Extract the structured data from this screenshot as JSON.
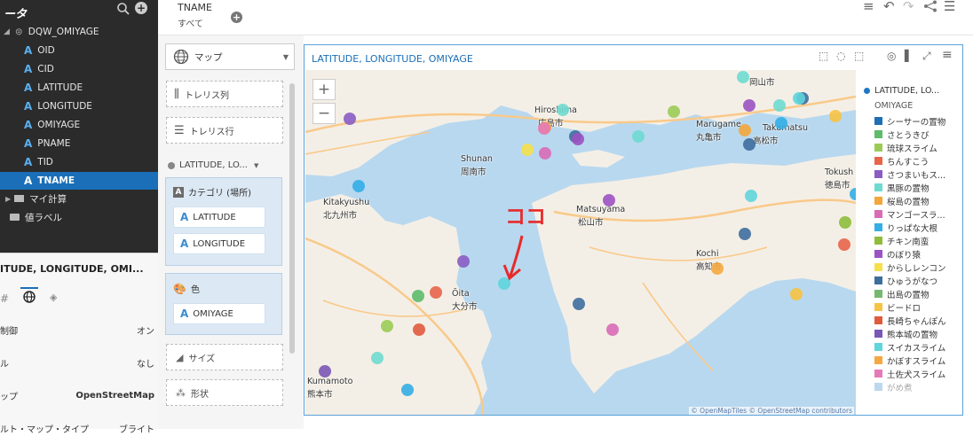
{
  "left_panel": {
    "title": "ータ",
    "tree": {
      "root": "DQW_OMIYAGE",
      "fields": [
        "OID",
        "CID",
        "LATITUDE",
        "LONGITUDE",
        "OMIYAGE",
        "PNAME",
        "TID",
        "TNAME"
      ],
      "selected": "TNAME",
      "folder": "マイ計算",
      "label_item": "値ラベル"
    }
  },
  "properties": {
    "title": "ITUDE, LONGITUDE, OMI...",
    "rows": [
      {
        "label": "制御",
        "value": "オン"
      },
      {
        "label": "ル",
        "value": "なし"
      },
      {
        "label": "ップ",
        "value": "OpenStreetMap"
      },
      {
        "label": "ルト・マップ・タイプ",
        "value": "ブライト"
      }
    ]
  },
  "top": {
    "filter_name": "TNAME",
    "filter_value": "すべて"
  },
  "grammar": {
    "viz_type": "マップ",
    "trellis_col": "トレリス列",
    "trellis_row": "トレリス行",
    "layer": "LATITUDE, LO...",
    "category_label": "カテゴリ (場所)",
    "category_items": [
      "LATITUDE",
      "LONGITUDE"
    ],
    "color_label": "色",
    "color_item": "OMIYAGE",
    "size_label": "サイズ",
    "shape_label": "形状"
  },
  "canvas": {
    "title": "LATITUDE, LONGITUDE, OMIYAGE",
    "attribution": "© OpenMapTiles  © OpenStreetMap contributors",
    "annotation": "ココ",
    "map_labels": [
      {
        "t": "Hiroshima"
      },
      {
        "t": "広島市"
      },
      {
        "t": "Shunan"
      },
      {
        "t": "周南市"
      },
      {
        "t": "Marugame"
      },
      {
        "t": "丸亀市"
      },
      {
        "t": "Takamatsu"
      },
      {
        "t": "高松市"
      },
      {
        "t": "Kitakyushu"
      },
      {
        "t": "北九州市"
      },
      {
        "t": "Matsuyama"
      },
      {
        "t": "松山市"
      },
      {
        "t": "Tokush"
      },
      {
        "t": "徳島市"
      },
      {
        "t": "Kochi"
      },
      {
        "t": "高知市"
      },
      {
        "t": "Ōita"
      },
      {
        "t": "大分市"
      },
      {
        "t": "Kumamoto"
      },
      {
        "t": "熊本市"
      },
      {
        "t": "岡山市"
      }
    ]
  },
  "legend": {
    "layer_name": "LATITUDE, LO...",
    "field": "OMIYAGE",
    "layer_color": "#1f77c4",
    "items": [
      {
        "label": "シーサーの置物",
        "color": "#1f6fb5"
      },
      {
        "label": "さとうきび",
        "color": "#5dbb6a"
      },
      {
        "label": "琉球スライム",
        "color": "#9bcb55"
      },
      {
        "label": "ちんすこう",
        "color": "#e8644a"
      },
      {
        "label": "さつまいもス...",
        "color": "#8a5cc4"
      },
      {
        "label": "黒豚の置物",
        "color": "#6fdad0"
      },
      {
        "label": "桜島の置物",
        "color": "#f3a63a"
      },
      {
        "label": "マンゴースラ...",
        "color": "#d86cb7"
      },
      {
        "label": "りっぱな大根",
        "color": "#33aee6"
      },
      {
        "label": "チキン南蛮",
        "color": "#8dbd3b"
      },
      {
        "label": "のぼり猿",
        "color": "#9b52c2"
      },
      {
        "label": "からしレンコン",
        "color": "#f6e04a"
      },
      {
        "label": "ひゅうがなつ",
        "color": "#3e6e9e"
      },
      {
        "label": "出島の置物",
        "color": "#76b870"
      },
      {
        "label": "ビードロ",
        "color": "#f7c342"
      },
      {
        "label": "長崎ちゃんぽん",
        "color": "#e05a3c"
      },
      {
        "label": "熊本城の置物",
        "color": "#7957b5"
      },
      {
        "label": "スイカスライム",
        "color": "#5fd5dc"
      },
      {
        "label": "かぼすスライム",
        "color": "#f5a840"
      },
      {
        "label": "土佐犬スライム",
        "color": "#e47ab8"
      },
      {
        "label": "がめ煮",
        "color": "#bcd8ee"
      }
    ]
  },
  "map_points_colors": [
    "#8a5cc4",
    "#6fdad0",
    "#f3a63a",
    "#d86cb7",
    "#3e6e9e",
    "#9b52c2",
    "#6fdad0",
    "#f6e04a",
    "#9bcb55",
    "#3e6e9e",
    "#33aee6",
    "#f3a63a",
    "#3e6e9e",
    "#5fd5dc",
    "#9b52c2",
    "#6fdad0",
    "#e8644a",
    "#8a5cc4",
    "#33aee6",
    "#5dbb6a",
    "#3e6e9e",
    "#9bcb55",
    "#6fdad0",
    "#e05a3c",
    "#d86cb7",
    "#33aee6",
    "#f7c342",
    "#8dbd3b",
    "#5fd5dc",
    "#3e6e9e",
    "#6fdad0",
    "#f5a840",
    "#7957b5",
    "#33aee6",
    "#e47ab8",
    "#f7c342",
    "#e8644a",
    "#5fd5dc",
    "#9b52c2"
  ]
}
